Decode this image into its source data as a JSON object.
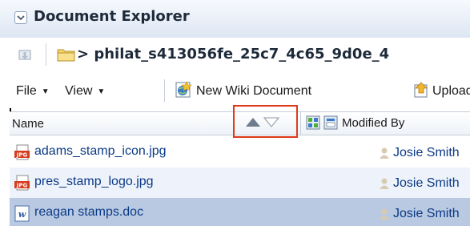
{
  "panel": {
    "title": "Document Explorer"
  },
  "breadcrumb": {
    "path": "> philat_s413056fe_25c7_4c65_9d0e_4"
  },
  "toolbar": {
    "file_label": "File",
    "view_label": "View",
    "new_wiki_label": "New Wiki Document",
    "upload_label": "Upload"
  },
  "table": {
    "columns": {
      "name": "Name",
      "modified_by": "Modified By"
    },
    "rows": [
      {
        "name": "adams_stamp_icon.jpg",
        "type": "jpg",
        "modified_by": "Josie Smith"
      },
      {
        "name": "pres_stamp_logo.jpg",
        "type": "jpg",
        "modified_by": "Josie Smith"
      },
      {
        "name": "reagan stamps.doc",
        "type": "doc",
        "modified_by": "Josie Smith"
      }
    ]
  },
  "colors": {
    "accent_highlight": "#e0391d",
    "selected_row": "#b9c9e2",
    "link": "#0b3a86"
  },
  "icons": [
    "chevron-down-icon",
    "navigate-up-icon",
    "folder-icon",
    "new-wiki-icon",
    "upload-icon",
    "sort-ascending-icon",
    "sort-descending-icon",
    "jpg-file-icon",
    "doc-file-icon",
    "user-icon"
  ]
}
